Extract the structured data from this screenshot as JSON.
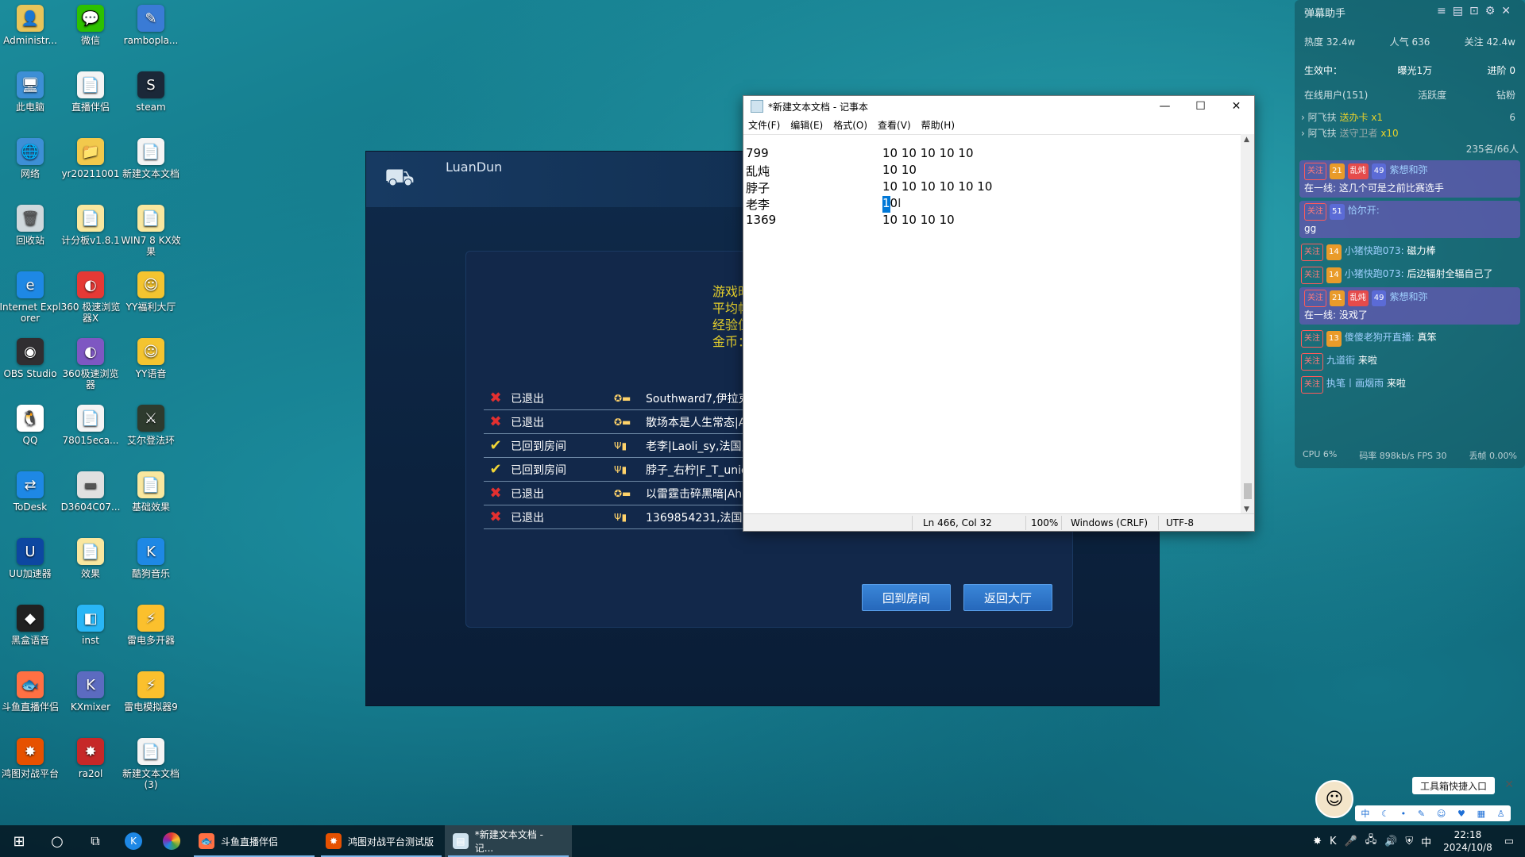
{
  "desktop": {
    "icons": [
      {
        "label": "Administr...",
        "glyph": "👤",
        "color": "#e8c45a"
      },
      {
        "label": "微信",
        "glyph": "💬",
        "color": "#2dc100"
      },
      {
        "label": "rambopla...",
        "glyph": "✎",
        "color": "#3a7bd5"
      },
      {
        "label": "此电脑",
        "glyph": "🖥",
        "color": "#3d8fd6"
      },
      {
        "label": "直播伴侣",
        "glyph": "📄",
        "color": "#f4f4f4"
      },
      {
        "label": "steam",
        "glyph": "S",
        "color": "#1b2838"
      },
      {
        "label": "网络",
        "glyph": "🌐",
        "color": "#3d8fd6"
      },
      {
        "label": "yr20211001",
        "glyph": "📁",
        "color": "#f2c94c"
      },
      {
        "label": "新建文本文档",
        "glyph": "📄",
        "color": "#f4f4f4"
      },
      {
        "label": "回收站",
        "glyph": "🗑",
        "color": "#cfd8dc"
      },
      {
        "label": "计分板v1.8.1",
        "glyph": "📄",
        "color": "#f9e79f"
      },
      {
        "label": "WIN7 8 KX效果",
        "glyph": "📄",
        "color": "#f9e79f"
      },
      {
        "label": "Internet Explorer",
        "glyph": "e",
        "color": "#1e88e5"
      },
      {
        "label": "360 极速浏览器X",
        "glyph": "◐",
        "color": "#e53935"
      },
      {
        "label": "YY福利大厅",
        "glyph": "☺",
        "color": "#f4c430"
      },
      {
        "label": "OBS Studio",
        "glyph": "◉",
        "color": "#302e31"
      },
      {
        "label": "360极速浏览器",
        "glyph": "◐",
        "color": "#7e57c2"
      },
      {
        "label": "YY语音",
        "glyph": "☺",
        "color": "#f4c430"
      },
      {
        "label": "QQ",
        "glyph": "🐧",
        "color": "#ffffff"
      },
      {
        "label": "78015eca...",
        "glyph": "📄",
        "color": "#f4f4f4"
      },
      {
        "label": "艾尔登法环",
        "glyph": "⚔",
        "color": "#2e3b2e"
      },
      {
        "label": "ToDesk",
        "glyph": "⇄",
        "color": "#1e88e5"
      },
      {
        "label": "D3604C07...",
        "glyph": "▬",
        "color": "#e0e0e0"
      },
      {
        "label": "基础效果",
        "glyph": "📄",
        "color": "#f9e79f"
      },
      {
        "label": "UU加速器",
        "glyph": "U",
        "color": "#0d47a1"
      },
      {
        "label": "效果",
        "glyph": "📄",
        "color": "#f9e79f"
      },
      {
        "label": "酷狗音乐",
        "glyph": "K",
        "color": "#1e88e5"
      },
      {
        "label": "黑盒语音",
        "glyph": "◆",
        "color": "#212121"
      },
      {
        "label": "inst",
        "glyph": "◧",
        "color": "#29b6f6"
      },
      {
        "label": "雷电多开器",
        "glyph": "⚡",
        "color": "#fbc02d"
      },
      {
        "label": "斗鱼直播伴侣",
        "glyph": "🐟",
        "color": "#ff7043"
      },
      {
        "label": "KXmixer",
        "glyph": "K",
        "color": "#5c6bc0"
      },
      {
        "label": "雷电模拟器9",
        "glyph": "⚡",
        "color": "#fbc02d"
      },
      {
        "label": "鸿图对战平台",
        "glyph": "✸",
        "color": "#e65100"
      },
      {
        "label": "ra2ol",
        "glyph": "✸",
        "color": "#c62828"
      },
      {
        "label": "新建文本文档 (3)",
        "glyph": "📄",
        "color": "#f4f4f4"
      }
    ]
  },
  "game": {
    "title": "LuanDun",
    "stats": [
      "游戏时",
      "平均帧",
      "经验值",
      "金币："
    ],
    "players": [
      {
        "status": "已退出",
        "ok": false,
        "flag": "✪▬",
        "name": "Southward7,伊拉克"
      },
      {
        "status": "已退出",
        "ok": false,
        "flag": "✪▬",
        "name": "散场本是人生常态|A"
      },
      {
        "status": "已回到房间",
        "ok": true,
        "flag": "Ψ▮",
        "name": "老李|Laoli_sy,法国,"
      },
      {
        "status": "已回到房间",
        "ok": true,
        "flag": "Ψ▮",
        "name": "脖子_右柠|F_T_unio"
      },
      {
        "status": "已退出",
        "ok": false,
        "flag": "✪▬",
        "name": "以雷霆击碎黑暗|Ah"
      },
      {
        "status": "已退出",
        "ok": false,
        "flag": "Ψ▮",
        "name": "1369854231,法国,"
      }
    ],
    "btn_room": "回到房间",
    "btn_lobby": "返回大厅"
  },
  "notepad": {
    "title": "*新建文本文档 - 记事本",
    "menu": [
      "文件(F)",
      "编辑(E)",
      "格式(O)",
      "查看(V)",
      "帮助(H)"
    ],
    "lines": [
      {
        "a": "799",
        "b": "10 10 10 10 10"
      },
      {
        "a": "乱炖",
        "b": "10 10"
      },
      {
        "a": "脖子",
        "b": "10 10 10 10 10 10"
      },
      {
        "a": "老李",
        "b_sel": "1",
        "b": "0"
      },
      {
        "a": "1369",
        "b": "10 10 10 10"
      }
    ],
    "status": {
      "pos": "Ln 466, Col 32",
      "zoom": "100%",
      "eol": "Windows (CRLF)",
      "enc": "UTF-8"
    }
  },
  "danmu": {
    "title": "弹幕助手",
    "heat": "热度 32.4w",
    "pop": "人气 636",
    "follow": "关注 42.4w",
    "live": "生效中：",
    "exposure": "曝光1万",
    "progress": "进阶 0",
    "tab_online": "在线用户(151)",
    "tab_active": "活跃度",
    "tab_gift": "钻粉",
    "gift1_user": "阿飞扶",
    "gift1_text": "送办卡",
    "gift1_count": "x1",
    "gift1_num": "6",
    "gift2_user": "阿飞扶",
    "gift2_text": "送守卫者",
    "gift2_count": "x10",
    "viewer_count": "235名/66人",
    "messages": [
      {
        "tag": "关注",
        "lv": "21",
        "badge": "乱炖",
        "fan": "49",
        "user": "紫想和弥",
        "text": "在一线: 这几个可是之前比赛选手",
        "card": true
      },
      {
        "tag": "关注",
        "lv": "",
        "badge": "",
        "fan": "51",
        "user": "恰尔开:",
        "text": "gg",
        "card": true
      },
      {
        "tag": "关注",
        "lv": "14",
        "badge": "",
        "fan": "",
        "user": "小猪快跑073:",
        "text": "磁力棒",
        "card": false
      },
      {
        "tag": "关注",
        "lv": "14",
        "badge": "",
        "fan": "",
        "user": "小猪快跑073:",
        "text": "后边辐射全辐自己了",
        "card": false
      },
      {
        "tag": "关注",
        "lv": "21",
        "badge": "乱炖",
        "fan": "49",
        "user": "紫想和弥",
        "text": "在一线: 没戏了",
        "card": true
      },
      {
        "tag": "关注",
        "lv": "13",
        "badge": "",
        "fan": "",
        "user": "傻傻老狗开直播:",
        "text": "真笨",
        "card": false
      },
      {
        "tag": "关注",
        "lv": "",
        "badge": "",
        "fan": "",
        "user": "九道街",
        "text": "来啦",
        "card": false
      },
      {
        "tag": "关注",
        "lv": "",
        "badge": "",
        "fan": "",
        "user": "执笔丨画烟雨",
        "text": "来啦",
        "card": false
      }
    ],
    "cpu": "CPU 6%",
    "bitrate": "码率 898kb/s FPS 30",
    "drop": "丢帧 0.00%"
  },
  "toolwidget": {
    "bubble": "工具箱快捷入口",
    "items": [
      "中",
      "☾",
      "•",
      "✎",
      "☺",
      "♥",
      "▦",
      "♙"
    ]
  },
  "taskbar": {
    "apps": [
      {
        "label": "斗鱼直播伴侣",
        "glyph": "🐟",
        "color": "#ff7043",
        "active": false
      },
      {
        "label": "鸿图对战平台测试版",
        "glyph": "✸",
        "color": "#e65100",
        "active": false
      },
      {
        "label": "*新建文本文档 - 记...",
        "glyph": "▤",
        "color": "#cfe3ef",
        "active": true
      }
    ],
    "ime": "中",
    "time": "22:18",
    "date": "2024/10/8"
  }
}
